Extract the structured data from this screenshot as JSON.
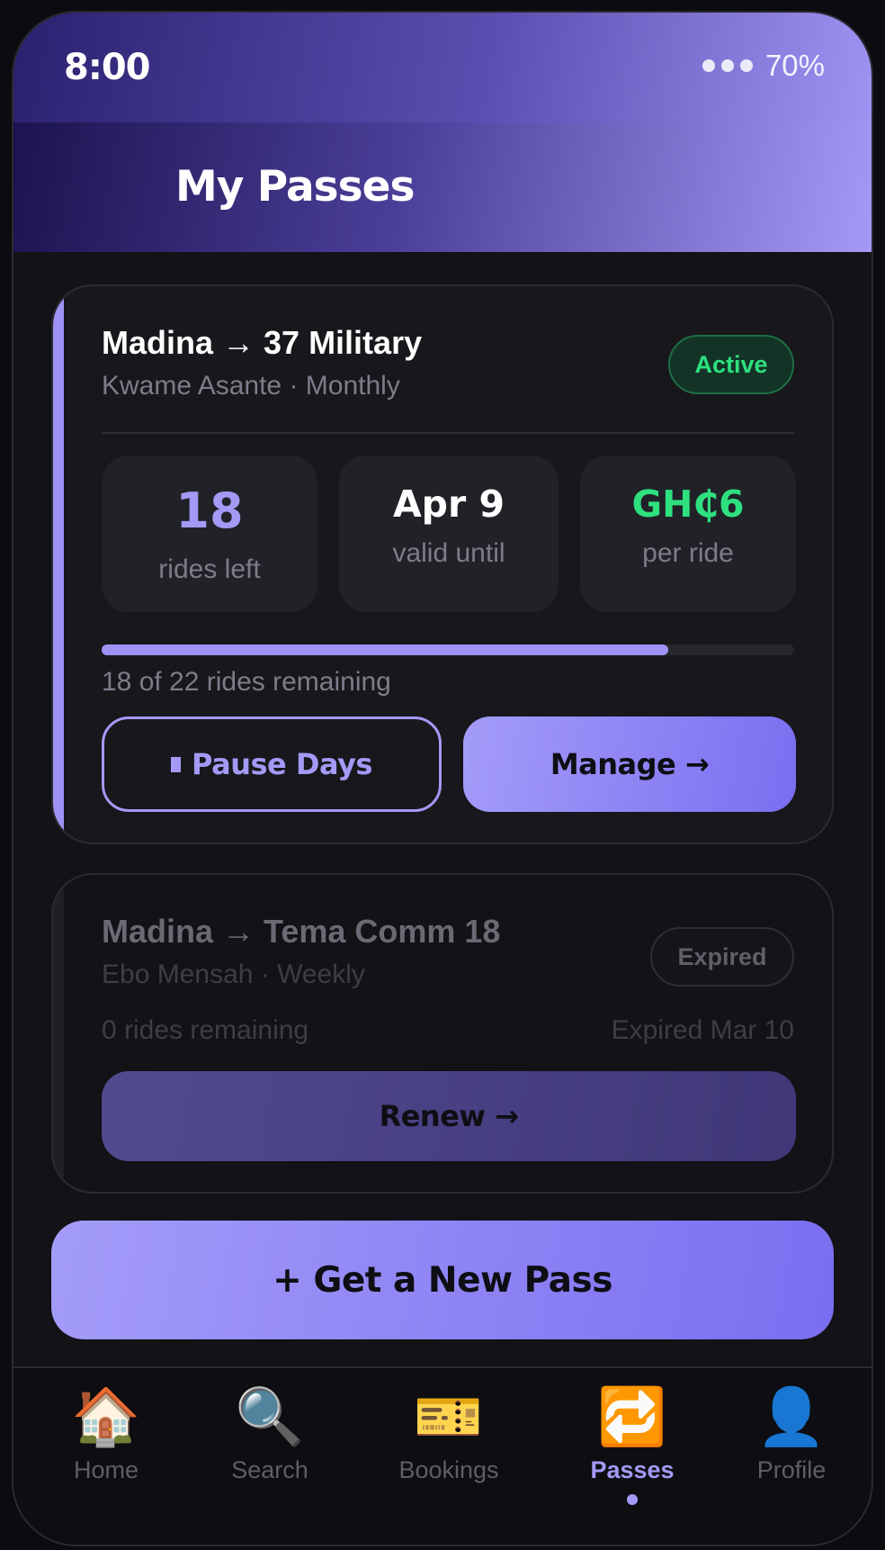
{
  "status": {
    "time": "8:00",
    "battery": "70%"
  },
  "header": {
    "title": "My Passes"
  },
  "passes": [
    {
      "route": "Madina → 37 Military",
      "subtitle": "Kwame Asante · Monthly",
      "status": "Active",
      "stats": [
        {
          "value": "18",
          "label": "rides left"
        },
        {
          "value": "Apr 9",
          "label": "valid until"
        },
        {
          "value": "GH₵6",
          "label": "per ride"
        }
      ],
      "progress": {
        "remaining": 18,
        "total": 22,
        "text": "18 of 22 rides remaining"
      },
      "actions": {
        "pause": "Pause Days",
        "manage": "Manage →"
      }
    },
    {
      "route": "Madina → Tema Comm 18",
      "subtitle": "Ebo Mensah · Weekly",
      "status": "Expired",
      "remaining_text": "0 rides remaining",
      "expired_text": "Expired Mar 10",
      "actions": {
        "renew": "Renew →"
      }
    }
  ],
  "cta": {
    "new_pass": "+ Get a New Pass"
  },
  "tabbar": {
    "items": [
      {
        "label": "Home",
        "icon": "🏠"
      },
      {
        "label": "Search",
        "icon": "🔍"
      },
      {
        "label": "Bookings",
        "icon": "🎫"
      },
      {
        "label": "Passes",
        "icon": "🔁"
      },
      {
        "label": "Profile",
        "icon": "👤"
      }
    ],
    "active": "Passes"
  },
  "colors": {
    "accent": "#9d93f5",
    "active_green": "#2ee07e",
    "background": "#121217"
  }
}
